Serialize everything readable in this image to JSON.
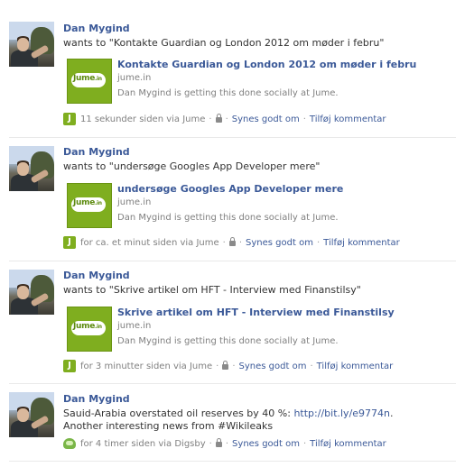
{
  "stories": [
    {
      "name": "Dan Mygind",
      "message": "wants to \"Kontakte Guardian og London 2012 om møder i febru\"",
      "attachment": {
        "title": "Kontakte Guardian og London 2012 om møder i febru",
        "domain": "jume.in",
        "description": "Dan Mygind is getting this done socially at Jume."
      },
      "app_icon": "jume-icon",
      "time": "11 sekunder siden via Jume",
      "like": "Synes godt om",
      "comment": "Tilføj kommentar"
    },
    {
      "name": "Dan Mygind",
      "message": "wants to \"undersøge Googles App Developer mere\"",
      "attachment": {
        "title": "undersøge Googles App Developer mere",
        "domain": "jume.in",
        "description": "Dan Mygind is getting this done socially at Jume."
      },
      "app_icon": "jume-icon",
      "time": "for ca. et minut siden via Jume",
      "like": "Synes godt om",
      "comment": "Tilføj kommentar"
    },
    {
      "name": "Dan Mygind",
      "message": "wants to \"Skrive artikel om HFT - Interview med Finanstilsy\"",
      "attachment": {
        "title": "Skrive artikel om HFT - Interview med Finanstilsy",
        "domain": "jume.in",
        "description": "Dan Mygind is getting this done socially at Jume."
      },
      "app_icon": "jume-icon",
      "time": "for 3 minutter siden via Jume",
      "like": "Synes godt om",
      "comment": "Tilføj kommentar"
    },
    {
      "name": "Dan Mygind",
      "message_prefix": "Sauid-Arabia overstated oil reserves by 40 %: ",
      "message_link": "http://bit.ly/e9774n",
      "message_suffix": ". Another interesting news from #Wikileaks",
      "app_icon": "digsby-icon",
      "time": "for 4 timer siden via Digsby",
      "like": "Synes godt om",
      "comment": "Tilføj kommentar"
    }
  ],
  "jume_logo_text": "Jume",
  "jume_logo_sup": ".in",
  "jume_icon_letter": "J",
  "colors": {
    "link": "#3b5998",
    "meta": "#808080",
    "jume_green": "#7fae1f",
    "divider": "#e9e9e9"
  }
}
